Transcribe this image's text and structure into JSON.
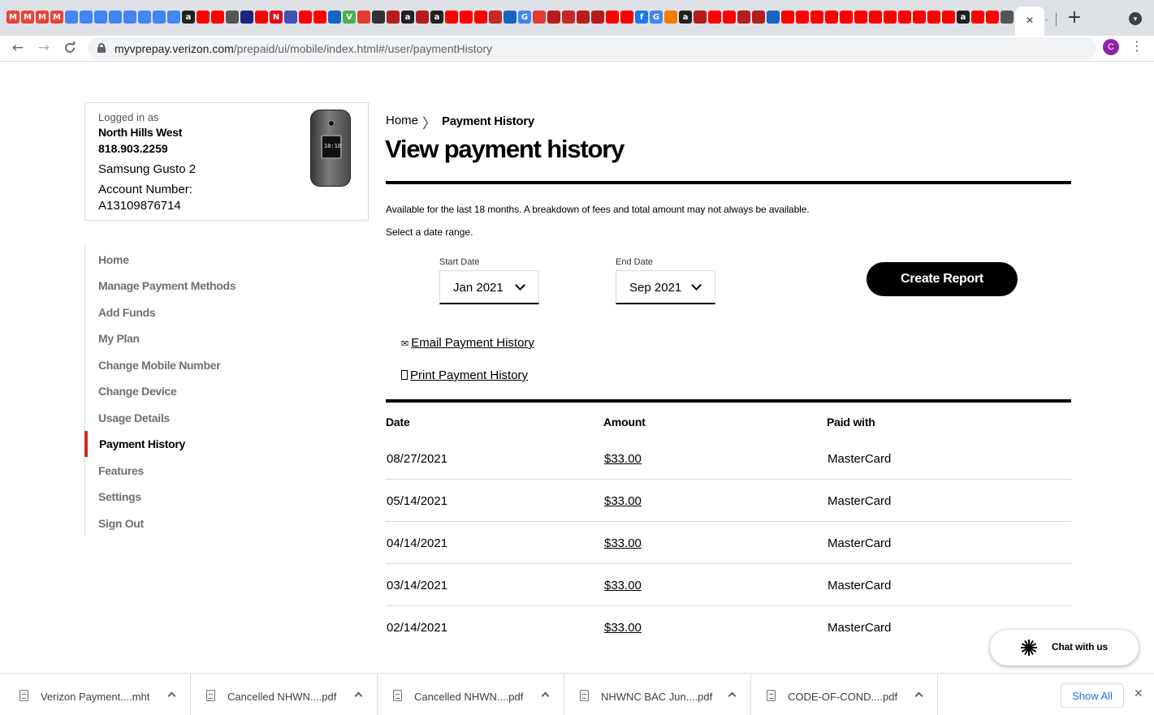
{
  "browser": {
    "favicon_colors": [
      "#ea4335",
      "#ea4335",
      "#ea4335",
      "#ea4335",
      "#4285f4",
      "#4285f4",
      "#4285f4",
      "#4285f4",
      "#4285f4",
      "#4285f4",
      "#4285f4",
      "#4285f4",
      "#222222",
      "#ff0000",
      "#ff0000",
      "#555555",
      "#1a237e",
      "#ff0000",
      "#e50914",
      "#3f51b5",
      "#ff0000",
      "#ff0000",
      "#1565c0",
      "#4caf50",
      "#e53935",
      "#333333",
      "#b71c1c",
      "#222222",
      "#b71c1c",
      "#222222",
      "#ff0000",
      "#ff0000",
      "#ff0000",
      "#c62828",
      "#1565c0",
      "#4285f4",
      "#e53935",
      "#b71c1c",
      "#c62828",
      "#b71c1c",
      "#b71c1c",
      "#ff0000",
      "#ff0000",
      "#1877f2",
      "#4285f4",
      "#f57c00",
      "#222222",
      "#b71c1c",
      "#ff0000",
      "#ff0000",
      "#b71c1c",
      "#b71c1c",
      "#1565c0",
      "#ff0000",
      "#ff0000",
      "#ff0000",
      "#ff0000",
      "#ff0000",
      "#ff0000",
      "#ff0000",
      "#ff0000",
      "#ff0000",
      "#ff0000",
      "#ff0000",
      "#ff0000",
      "#222222",
      "#ff0000",
      "#ff0000",
      "#555555",
      "#1a73e8"
    ],
    "favicon_glyphs": [
      "M",
      "M",
      "M",
      "M",
      "",
      "",
      "",
      "",
      "",
      "",
      "",
      "",
      "a",
      "",
      "",
      "",
      "",
      "",
      "N",
      "",
      "",
      "",
      "",
      "V",
      "",
      "",
      "",
      "a",
      "",
      "a",
      "",
      "",
      "",
      "",
      "",
      "G",
      "",
      "",
      "",
      "",
      "",
      "",
      "",
      "f",
      "G",
      "",
      "a",
      "",
      "",
      "",
      "",
      "",
      "",
      "",
      "",
      "",
      "",
      "",
      "",
      "",
      "",
      "",
      "",
      "",
      "",
      "a",
      "",
      "",
      "",
      ""
    ],
    "active_tab_close": "×",
    "new_tab": "+",
    "url_host": "myvprepay.verizon.com",
    "url_path": "/prepaid/ui/mobile/index.html#/user/paymentHistory",
    "profile_initial": "C",
    "back_icon": "←",
    "forward_icon": "→",
    "reload_icon": "C",
    "star_icon": "☆",
    "menu_icon": "⋮"
  },
  "account": {
    "logged_in_label": "Logged in as",
    "name": "North Hills West",
    "phone": "818.903.2259",
    "device": "Samsung Gusto 2",
    "account_number_label": "Account Number:",
    "account_number": "A13109876714",
    "device_screen_time": "10:10"
  },
  "sidebar": {
    "items": [
      {
        "label": "Home"
      },
      {
        "label": "Manage Payment Methods"
      },
      {
        "label": "Add Funds"
      },
      {
        "label": "My Plan"
      },
      {
        "label": "Change Mobile Number"
      },
      {
        "label": "Change Device"
      },
      {
        "label": "Usage Details"
      },
      {
        "label": "Payment History"
      },
      {
        "label": "Features"
      },
      {
        "label": "Settings"
      },
      {
        "label": "Sign Out"
      }
    ],
    "active": "Payment History"
  },
  "breadcrumb": {
    "home": "Home",
    "separator": "〉",
    "current": "Payment History"
  },
  "main": {
    "title": "View payment history",
    "intro": "Available for the last 18 months. A breakdown of fees and total amount may not always be available.",
    "select_prompt": "Select a date range.",
    "start_date_label": "Start Date",
    "start_date_value": "Jan 2021",
    "end_date_label": "End Date",
    "end_date_value": "Sep 2021",
    "create_report": "Create Report",
    "email_icon": "✉",
    "email_link": "Email Payment History",
    "print_link": "Print Payment History"
  },
  "table": {
    "headers": [
      "Date",
      "Amount",
      "Paid with"
    ],
    "rows": [
      {
        "date": "08/27/2021",
        "amount": "$33.00",
        "paid_with": "MasterCard"
      },
      {
        "date": "05/14/2021",
        "amount": "$33.00",
        "paid_with": "MasterCard"
      },
      {
        "date": "04/14/2021",
        "amount": "$33.00",
        "paid_with": "MasterCard"
      },
      {
        "date": "03/14/2021",
        "amount": "$33.00",
        "paid_with": "MasterCard"
      },
      {
        "date": "02/14/2021",
        "amount": "$33.00",
        "paid_with": "MasterCard"
      }
    ]
  },
  "chat": {
    "label": "Chat with us"
  },
  "downloads": {
    "items": [
      {
        "name": "Verizon Payment....mht"
      },
      {
        "name": "Cancelled NHWN....pdf"
      },
      {
        "name": "Cancelled NHWN....pdf"
      },
      {
        "name": "NHWNC BAC Jun....pdf"
      },
      {
        "name": "CODE-OF-COND....pdf"
      }
    ],
    "show_all": "Show All",
    "close_icon": "✕"
  }
}
